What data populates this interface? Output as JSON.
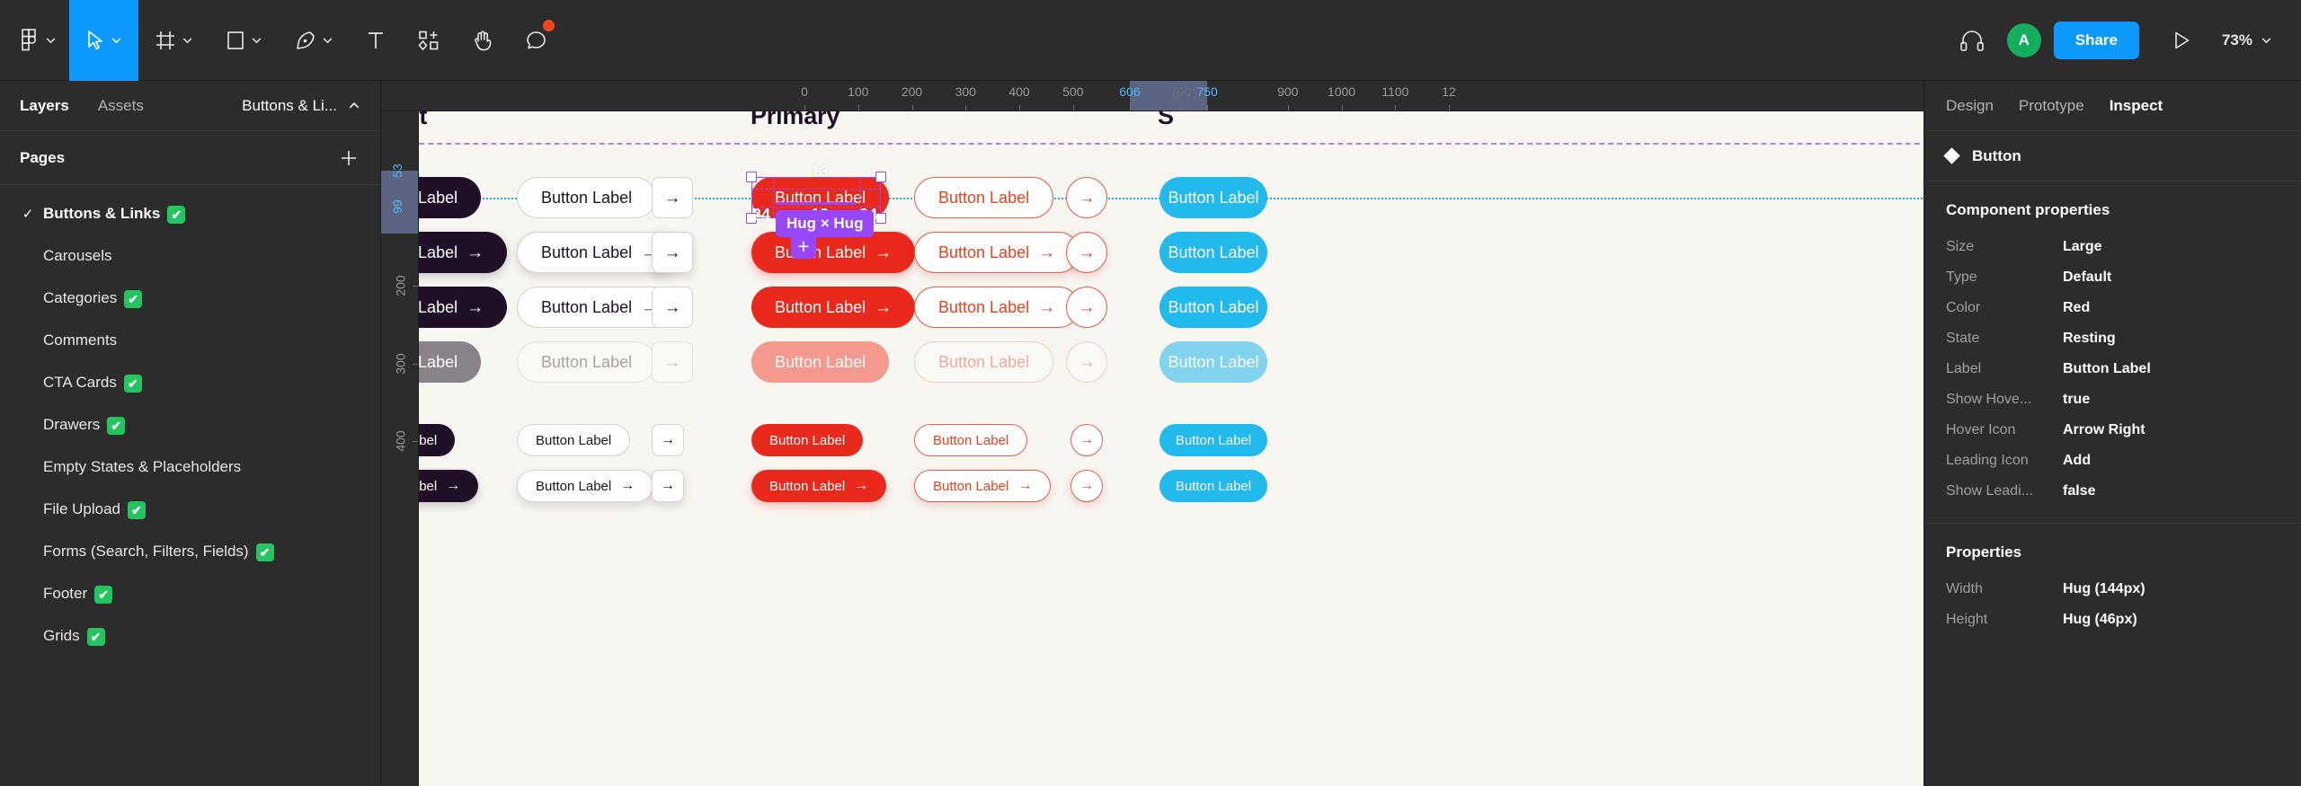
{
  "toolbar": {
    "tools": [
      {
        "name": "figma-logo-icon",
        "caret": true
      },
      {
        "name": "move-tool-icon",
        "caret": true,
        "active": true
      },
      {
        "name": "frame-tool-icon",
        "caret": true
      },
      {
        "name": "shape-tool-icon",
        "caret": true
      },
      {
        "name": "pen-tool-icon",
        "caret": true
      },
      {
        "name": "text-tool-icon",
        "caret": false
      },
      {
        "name": "components-tool-icon",
        "caret": false
      },
      {
        "name": "hand-tool-icon",
        "caret": false
      },
      {
        "name": "comment-tool-icon",
        "caret": false
      }
    ],
    "headset_icon": "headset-icon",
    "avatar_initial": "A",
    "avatar_color": "#14ae5c",
    "share_label": "Share",
    "present_icon": "play-icon",
    "zoom_level": "73%",
    "accent_color": "#0d99ff",
    "notification_color": "#f24822"
  },
  "left_panel": {
    "tabs": [
      {
        "label": "Layers",
        "active": true
      },
      {
        "label": "Assets",
        "active": false
      }
    ],
    "file_name": "Buttons & Li...",
    "pages_title": "Pages",
    "add_page_icon": "plus-icon",
    "pages": [
      {
        "label": "Buttons & Links",
        "checked": true,
        "selected": true
      },
      {
        "label": "Carousels",
        "checked": false,
        "selected": false
      },
      {
        "label": "Categories",
        "checked": true,
        "selected": false
      },
      {
        "label": "Comments",
        "checked": false,
        "selected": false
      },
      {
        "label": "CTA Cards",
        "checked": true,
        "selected": false
      },
      {
        "label": "Drawers",
        "checked": true,
        "selected": false
      },
      {
        "label": "Empty States & Placeholders",
        "checked": false,
        "selected": false
      },
      {
        "label": "File Upload",
        "checked": true,
        "selected": false
      },
      {
        "label": "Forms (Search, Filters, Fields)",
        "checked": true,
        "selected": false
      },
      {
        "label": "Footer",
        "checked": true,
        "selected": false
      },
      {
        "label": "Grids",
        "checked": true,
        "selected": false
      }
    ]
  },
  "rulers": {
    "horizontal_ticks": [
      "0",
      "100",
      "200",
      "300",
      "400",
      "500",
      "606",
      "700",
      "750",
      "900",
      "1000",
      "1100",
      "12"
    ],
    "horizontal_accent": [
      "606",
      "750"
    ],
    "horizontal_dim": [
      "700"
    ],
    "vertical_ticks": [
      "53",
      "99",
      "200",
      "300",
      "400"
    ],
    "vertical_accent": [
      "53",
      "99"
    ]
  },
  "canvas": {
    "background": "#f8f6f1",
    "columns": [
      {
        "title": "Default"
      },
      {
        "title": "Primary"
      },
      {
        "title": "S"
      }
    ],
    "button_label": "Button Label",
    "arrow_glyph": "→",
    "colors": {
      "dark": "#1f1028",
      "red": "#e8291c",
      "red_outline": "#ef5c44",
      "cyan": "#22b9ec",
      "disabled_gray": "#8a8289",
      "frame_dash": "#b57fe8",
      "guide": "#1eaaf1"
    }
  },
  "selection": {
    "padding_top": "13",
    "padding_bottom": "13",
    "padding_left": "24",
    "padding_right": "24",
    "size_badge": "Hug × Hug",
    "add_badge": "+",
    "accent": "#9747ff"
  },
  "right_panel": {
    "tabs": [
      {
        "label": "Design",
        "active": false
      },
      {
        "label": "Prototype",
        "active": false
      },
      {
        "label": "Inspect",
        "active": true
      }
    ],
    "component_icon": "component-diamond-icon",
    "component_name": "Button",
    "component_properties_title": "Component properties",
    "component_properties": [
      {
        "key": "Size",
        "value": "Large"
      },
      {
        "key": "Type",
        "value": "Default"
      },
      {
        "key": "Color",
        "value": "Red"
      },
      {
        "key": "State",
        "value": "Resting"
      },
      {
        "key": "Label",
        "value": "Button Label"
      },
      {
        "key": "Show Hove...",
        "value": "true"
      },
      {
        "key": "Hover Icon",
        "value": "Arrow Right"
      },
      {
        "key": "Leading Icon",
        "value": "Add"
      },
      {
        "key": "Show Leadi...",
        "value": "false"
      }
    ],
    "properties_title": "Properties",
    "properties": [
      {
        "key": "Width",
        "value": "Hug (144px)"
      },
      {
        "key": "Height",
        "value": "Hug (46px)"
      }
    ]
  }
}
